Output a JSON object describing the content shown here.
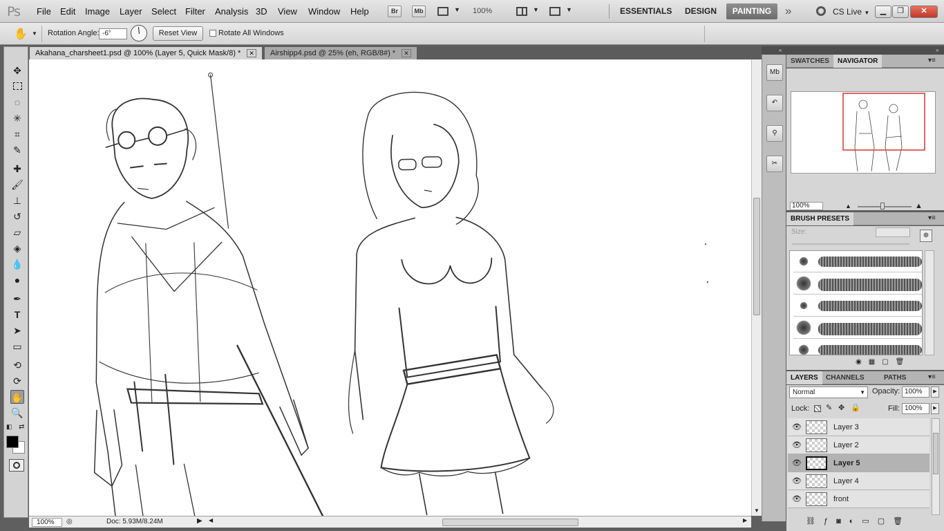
{
  "app": {
    "logo": "Ps"
  },
  "menu": [
    "File",
    "Edit",
    "Image",
    "Layer",
    "Select",
    "Filter",
    "Analysis",
    "3D",
    "View",
    "Window",
    "Help"
  ],
  "appbar": {
    "bridge": "Br",
    "minibridge": "Mb",
    "zoom": "100%"
  },
  "workspaces": {
    "essentials": "ESSENTIALS",
    "design": "DESIGN",
    "painting": "PAINTING",
    "more": "»",
    "cslive": "CS Live"
  },
  "options": {
    "rotation_label": "Rotation Angle:",
    "rotation_value": "-6°",
    "reset_label": "Reset View",
    "rotate_all_label": "Rotate All Windows"
  },
  "tabs": [
    {
      "label": "Akahana_charsheet1.psd @ 100% (Layer 5, Quick Mask/8) *",
      "active": true
    },
    {
      "label": "Airshipp4.psd @ 25% (eh, RGB/8#) *",
      "active": false
    }
  ],
  "status": {
    "zoom": "100%",
    "doc": "Doc: 5.93M/8.24M"
  },
  "navigator": {
    "tabs": [
      "SWATCHES",
      "NAVIGATOR"
    ],
    "zoom": "100%"
  },
  "brush_presets": {
    "title": "BRUSH PRESETS",
    "size_label": "Size:"
  },
  "layers_panel": {
    "tabs": [
      "LAYERS",
      "CHANNELS",
      "PATHS"
    ],
    "blend_mode": "Normal",
    "opacity_label": "Opacity:",
    "opacity_value": "100%",
    "lock_label": "Lock:",
    "fill_label": "Fill:",
    "fill_value": "100%",
    "layers": [
      {
        "name": "Layer 3",
        "selected": false
      },
      {
        "name": "Layer 2",
        "selected": false
      },
      {
        "name": "Layer 5",
        "selected": true
      },
      {
        "name": "Layer 4",
        "selected": false
      },
      {
        "name": "front",
        "selected": false
      }
    ]
  },
  "colors": {
    "accent_selected": "#6d6d6d",
    "navigator_frame": "#d94040"
  }
}
